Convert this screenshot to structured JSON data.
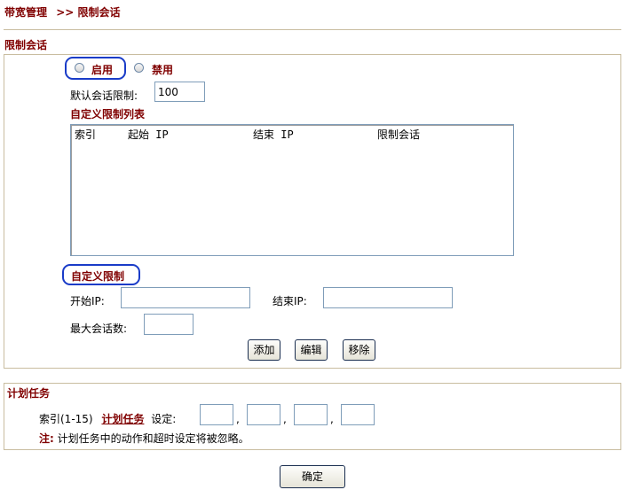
{
  "breadcrumb": {
    "root": "带宽管理",
    "separator": ">>",
    "current": "限制会话"
  },
  "section_session": {
    "title": "限制会话",
    "radio_enable": "启用",
    "radio_disable": "禁用",
    "default_limit_label": "默认会话限制:",
    "default_limit_value": "100",
    "custom_list_title": "自定义限制列表",
    "list_columns": [
      "索引",
      "起始 IP",
      "结束 IP",
      "限制会话"
    ],
    "custom_limit_title": "自定义限制",
    "start_ip_label": "开始IP:",
    "end_ip_label": "结束IP:",
    "max_sessions_label": "最大会话数:",
    "add_button": "添加",
    "edit_button": "编辑",
    "remove_button": "移除"
  },
  "section_schedule": {
    "title": "计划任务",
    "index_label": "索引(1-15)",
    "schedule_link": "计划任务",
    "setting_label": "设定:",
    "note_prefix": "注:",
    "note_text": "计划任务中的动作和超时设定将被忽略。"
  },
  "ok_button": "确定",
  "colors": {
    "accent": "#800000",
    "highlight": "#1a3cc8",
    "border": "#c9bda0"
  }
}
